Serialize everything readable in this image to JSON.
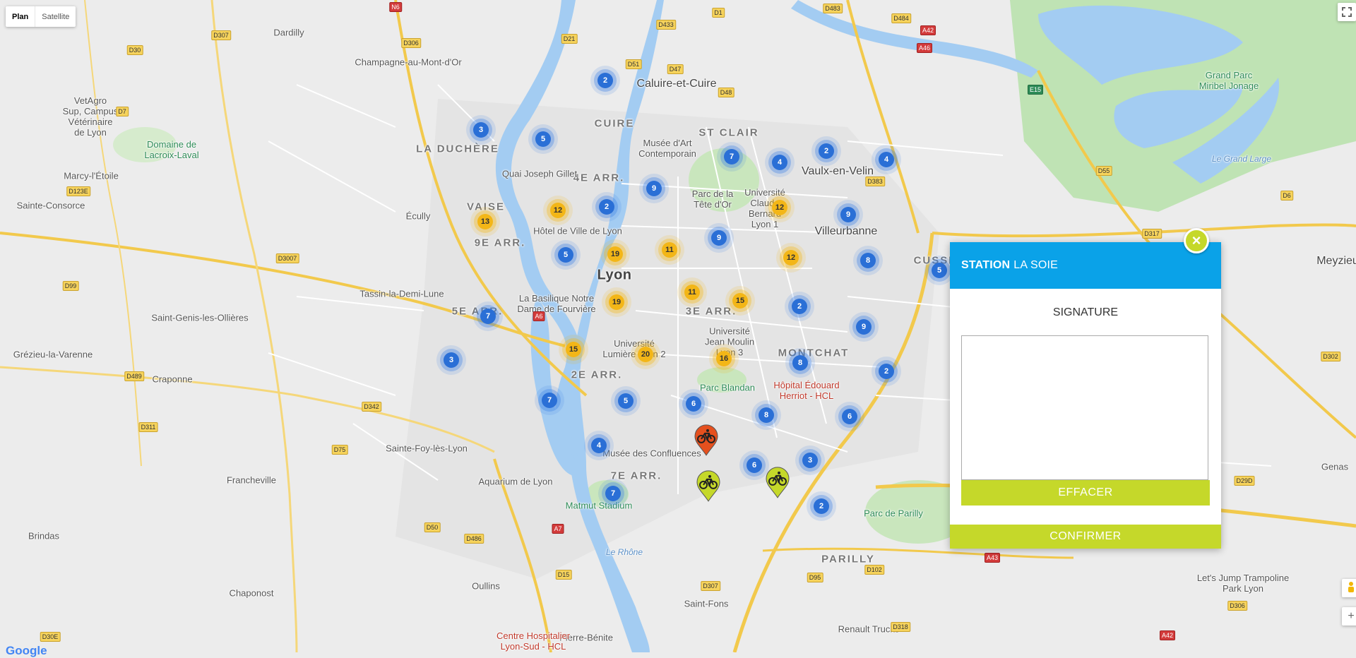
{
  "map_type": {
    "plan": "Plan",
    "satellite": "Satellite"
  },
  "places": [
    {
      "name": "Lyon",
      "cls": "city"
    },
    {
      "name": "Villeurbanne",
      "cls": "big"
    },
    {
      "name": "Vaulx-en-Velin",
      "cls": "big"
    },
    {
      "name": "Caluire-et-Cuire",
      "cls": "big"
    },
    {
      "name": "Meyzieu",
      "cls": "big"
    },
    {
      "name": "Dardilly",
      "cls": ""
    },
    {
      "name": "Champagne-au-Mont-d'Or",
      "cls": ""
    },
    {
      "name": "Marcy-l'Étoile",
      "cls": ""
    },
    {
      "name": "Sainte-Consorce",
      "cls": ""
    },
    {
      "name": "Écully",
      "cls": ""
    },
    {
      "name": "Tassin-la-Demi-Lune",
      "cls": ""
    },
    {
      "name": "Saint-Genis-les-Ollières",
      "cls": ""
    },
    {
      "name": "Grézieu-la-Varenne",
      "cls": ""
    },
    {
      "name": "Craponne",
      "cls": ""
    },
    {
      "name": "Francheville",
      "cls": ""
    },
    {
      "name": "Sainte-Foy-lès-Lyon",
      "cls": ""
    },
    {
      "name": "Brindas",
      "cls": ""
    },
    {
      "name": "Chaponost",
      "cls": ""
    },
    {
      "name": "Oullins",
      "cls": ""
    },
    {
      "name": "Saint-Fons",
      "cls": ""
    },
    {
      "name": "Pierre-Bénite",
      "cls": ""
    },
    {
      "name": "Genas",
      "cls": ""
    },
    {
      "name": "Parc de Parilly",
      "cls": "green"
    },
    {
      "name": "Grand Parc\nMiribel Jonage",
      "cls": "green"
    },
    {
      "name": "Parc de la\nTête d'Or",
      "cls": ""
    },
    {
      "name": "Parc Blandan",
      "cls": "green"
    },
    {
      "name": "Hôtel de Ville de Lyon",
      "cls": ""
    },
    {
      "name": "La Basilique Notre\nDame de Fourvière",
      "cls": ""
    },
    {
      "name": "Musée d'Art\nContemporain",
      "cls": ""
    },
    {
      "name": "Musée des Confluences",
      "cls": ""
    },
    {
      "name": "Aquarium de Lyon",
      "cls": ""
    },
    {
      "name": "Matmut Stadium",
      "cls": "green"
    },
    {
      "name": "Hôpital Édouard\nHerriot - HCL",
      "cls": "red"
    },
    {
      "name": "Centre Hospitalier\nLyon-Sud - HCL",
      "cls": "red"
    },
    {
      "name": "Renault Trucks",
      "cls": ""
    },
    {
      "name": "Let's Jump Trampoline\nPark Lyon",
      "cls": ""
    },
    {
      "name": "Domaine de\nLacroix-Laval",
      "cls": "green"
    },
    {
      "name": "VetAgro\nSup, Campus\nVétérinaire\nde Lyon",
      "cls": ""
    },
    {
      "name": "Université\nLumière Lyon 2",
      "cls": ""
    },
    {
      "name": "Université\nJean Moulin\nLyon 3",
      "cls": ""
    },
    {
      "name": "Université\nClaude\nBernard\nLyon 1",
      "cls": ""
    },
    {
      "name": "CUIRE",
      "cls": "arr"
    },
    {
      "name": "LA DUCHÈRE",
      "cls": "arr"
    },
    {
      "name": "4E ARR.",
      "cls": "arr"
    },
    {
      "name": "VAISE",
      "cls": "arr"
    },
    {
      "name": "9E ARR.",
      "cls": "arr"
    },
    {
      "name": "5E ARR.",
      "cls": "arr"
    },
    {
      "name": "2E ARR.",
      "cls": "arr"
    },
    {
      "name": "7E ARR.",
      "cls": "arr"
    },
    {
      "name": "3E ARR.",
      "cls": "arr"
    },
    {
      "name": "ST CLAIR",
      "cls": "arr"
    },
    {
      "name": "CUSSET",
      "cls": "arr"
    },
    {
      "name": "MONTCHAT",
      "cls": "arr"
    },
    {
      "name": "PARILLY",
      "cls": "arr"
    },
    {
      "name": "Quai Joseph Gillet",
      "cls": ""
    },
    {
      "name": "Le Rhône",
      "cls": "water"
    },
    {
      "name": "Le Grand Large",
      "cls": "water"
    }
  ],
  "roads": [
    {
      "name": "N6",
      "cls": "red"
    },
    {
      "name": "D1",
      "cls": ""
    },
    {
      "name": "D483",
      "cls": ""
    },
    {
      "name": "D484",
      "cls": ""
    },
    {
      "name": "D307",
      "cls": ""
    },
    {
      "name": "D306",
      "cls": ""
    },
    {
      "name": "D21",
      "cls": ""
    },
    {
      "name": "D433",
      "cls": ""
    },
    {
      "name": "D51",
      "cls": ""
    },
    {
      "name": "D47",
      "cls": ""
    },
    {
      "name": "D48",
      "cls": ""
    },
    {
      "name": "A42",
      "cls": "red"
    },
    {
      "name": "A46",
      "cls": "red"
    },
    {
      "name": "E15",
      "cls": "green"
    },
    {
      "name": "D30",
      "cls": ""
    },
    {
      "name": "D7",
      "cls": ""
    },
    {
      "name": "D123E",
      "cls": ""
    },
    {
      "name": "D3007",
      "cls": ""
    },
    {
      "name": "D383",
      "cls": ""
    },
    {
      "name": "D55",
      "cls": ""
    },
    {
      "name": "D6",
      "cls": ""
    },
    {
      "name": "D317",
      "cls": ""
    },
    {
      "name": "D99",
      "cls": ""
    },
    {
      "name": "A6",
      "cls": "red"
    },
    {
      "name": "D489",
      "cls": ""
    },
    {
      "name": "D342",
      "cls": ""
    },
    {
      "name": "D311",
      "cls": ""
    },
    {
      "name": "D75",
      "cls": ""
    },
    {
      "name": "D50",
      "cls": ""
    },
    {
      "name": "D486",
      "cls": ""
    },
    {
      "name": "A7",
      "cls": "red"
    },
    {
      "name": "D15",
      "cls": ""
    },
    {
      "name": "D307",
      "cls": ""
    },
    {
      "name": "D95",
      "cls": ""
    },
    {
      "name": "D102",
      "cls": ""
    },
    {
      "name": "A43",
      "cls": "red"
    },
    {
      "name": "D29D",
      "cls": ""
    },
    {
      "name": "D302",
      "cls": ""
    },
    {
      "name": "D306",
      "cls": ""
    },
    {
      "name": "D318",
      "cls": ""
    },
    {
      "name": "D30E",
      "cls": ""
    },
    {
      "name": "A42",
      "cls": "red"
    }
  ],
  "clusters": [
    {
      "n": "2",
      "c": "blue"
    },
    {
      "n": "3",
      "c": "blue"
    },
    {
      "n": "5",
      "c": "blue"
    },
    {
      "n": "7",
      "c": "blue"
    },
    {
      "n": "4",
      "c": "blue"
    },
    {
      "n": "2",
      "c": "blue"
    },
    {
      "n": "4",
      "c": "blue"
    },
    {
      "n": "12",
      "c": "yellow"
    },
    {
      "n": "2",
      "c": "blue"
    },
    {
      "n": "9",
      "c": "blue"
    },
    {
      "n": "12",
      "c": "yellow"
    },
    {
      "n": "13",
      "c": "yellow"
    },
    {
      "n": "9",
      "c": "blue"
    },
    {
      "n": "5",
      "c": "blue"
    },
    {
      "n": "19",
      "c": "yellow"
    },
    {
      "n": "11",
      "c": "yellow"
    },
    {
      "n": "12",
      "c": "yellow"
    },
    {
      "n": "8",
      "c": "blue"
    },
    {
      "n": "5",
      "c": "blue"
    },
    {
      "n": "11",
      "c": "yellow"
    },
    {
      "n": "15",
      "c": "yellow"
    },
    {
      "n": "19",
      "c": "yellow"
    },
    {
      "n": "7",
      "c": "blue"
    },
    {
      "n": "2",
      "c": "blue"
    },
    {
      "n": "9",
      "c": "blue"
    },
    {
      "n": "15",
      "c": "yellow"
    },
    {
      "n": "20",
      "c": "yellow"
    },
    {
      "n": "16",
      "c": "yellow"
    },
    {
      "n": "3",
      "c": "blue"
    },
    {
      "n": "8",
      "c": "blue"
    },
    {
      "n": "2",
      "c": "blue"
    },
    {
      "n": "7",
      "c": "blue"
    },
    {
      "n": "5",
      "c": "blue"
    },
    {
      "n": "6",
      "c": "blue"
    },
    {
      "n": "8",
      "c": "blue"
    },
    {
      "n": "6",
      "c": "blue"
    },
    {
      "n": "4",
      "c": "blue"
    },
    {
      "n": "6",
      "c": "blue"
    },
    {
      "n": "3",
      "c": "blue"
    },
    {
      "n": "2",
      "c": "blue"
    },
    {
      "n": "7",
      "c": "blue"
    },
    {
      "n": "9",
      "c": "blue"
    }
  ],
  "pins": [
    {
      "color": "#e5501e"
    },
    {
      "color": "#c5d82a"
    },
    {
      "color": "#c5d82a"
    }
  ],
  "panel": {
    "station_label": "STATION",
    "station_name": "LA SOIE",
    "close": "×",
    "signature_title": "SIGNATURE",
    "clear_button": "EFFACER",
    "confirm_button": "CONFIRMER"
  },
  "google_logo": "Google",
  "colors": {
    "header": "#0aa2e8",
    "accent": "#c5d82a",
    "cluster_blue": "#2a6fd6",
    "cluster_yellow": "#f3b617"
  }
}
